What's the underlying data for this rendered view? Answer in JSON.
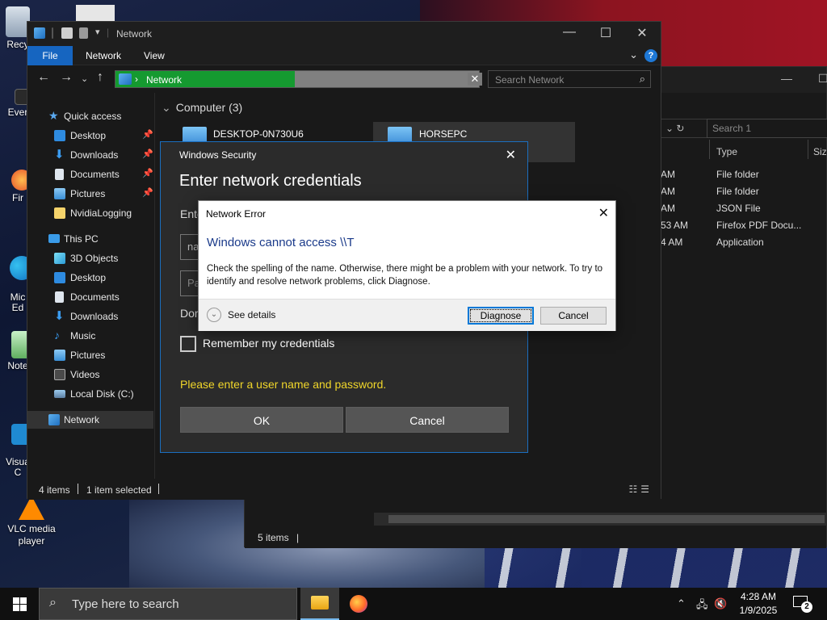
{
  "desktop": {
    "icons": [
      {
        "label": "Recy"
      },
      {
        "label": "Ever"
      },
      {
        "label": "Fir"
      },
      {
        "label": "Mic\nEd"
      },
      {
        "label": "Note"
      },
      {
        "label": "Visua\nC"
      },
      {
        "label": "VLC media player"
      }
    ]
  },
  "explorer": {
    "title": "Network",
    "ribbon_tabs": [
      "File",
      "Network",
      "View"
    ],
    "address": "Network",
    "search_placeholder": "Search Network",
    "nav": {
      "quick_access": "Quick access",
      "qa_items": [
        "Desktop",
        "Downloads",
        "Documents",
        "Pictures",
        "NvidiaLogging"
      ],
      "this_pc": "This PC",
      "pc_items": [
        "3D Objects",
        "Desktop",
        "Documents",
        "Downloads",
        "Music",
        "Pictures",
        "Videos",
        "Local Disk (C:)"
      ],
      "network": "Network"
    },
    "group_header": "Computer (3)",
    "computers": [
      "DESKTOP-0N730U6",
      "HORSEPC"
    ],
    "status_items": "4 items",
    "status_selected": "1 item selected"
  },
  "explorer_back": {
    "search_placeholder": "Search 1",
    "col_type": "Type",
    "col_size": "Size",
    "rows": [
      {
        "time": "AM",
        "type": "File folder"
      },
      {
        "time": "AM",
        "type": "File folder"
      },
      {
        "time": "AM",
        "type": "JSON File"
      },
      {
        "time": "53 AM",
        "type": "Firefox PDF Docu..."
      },
      {
        "time": "4 AM",
        "type": "Application"
      }
    ],
    "status": "5 items"
  },
  "winsec": {
    "header": "Windows Security",
    "heading": "Enter network credentials",
    "subtext": "Ente",
    "username_value": "na",
    "password_placeholder": "Pa",
    "domain": "Dor",
    "remember": "Remember my credentials",
    "warning": "Please enter a user name and password.",
    "ok": "OK",
    "cancel": "Cancel"
  },
  "neterr": {
    "title": "Network Error",
    "main": "Windows cannot access \\\\T",
    "body": "Check the spelling of the name. Otherwise, there might be a problem with your network. To try to identify and resolve network problems, click Diagnose.",
    "details": "See details",
    "diagnose": "Diagnose",
    "cancel": "Cancel"
  },
  "taskbar": {
    "search_placeholder": "Type here to search",
    "time": "4:28 AM",
    "date": "1/9/2025",
    "notifications": "2"
  },
  "colors": {
    "accent": "#1665c0",
    "progress": "#159a30",
    "warning": "#f0d62a",
    "error_title": "#1a3a8a"
  }
}
